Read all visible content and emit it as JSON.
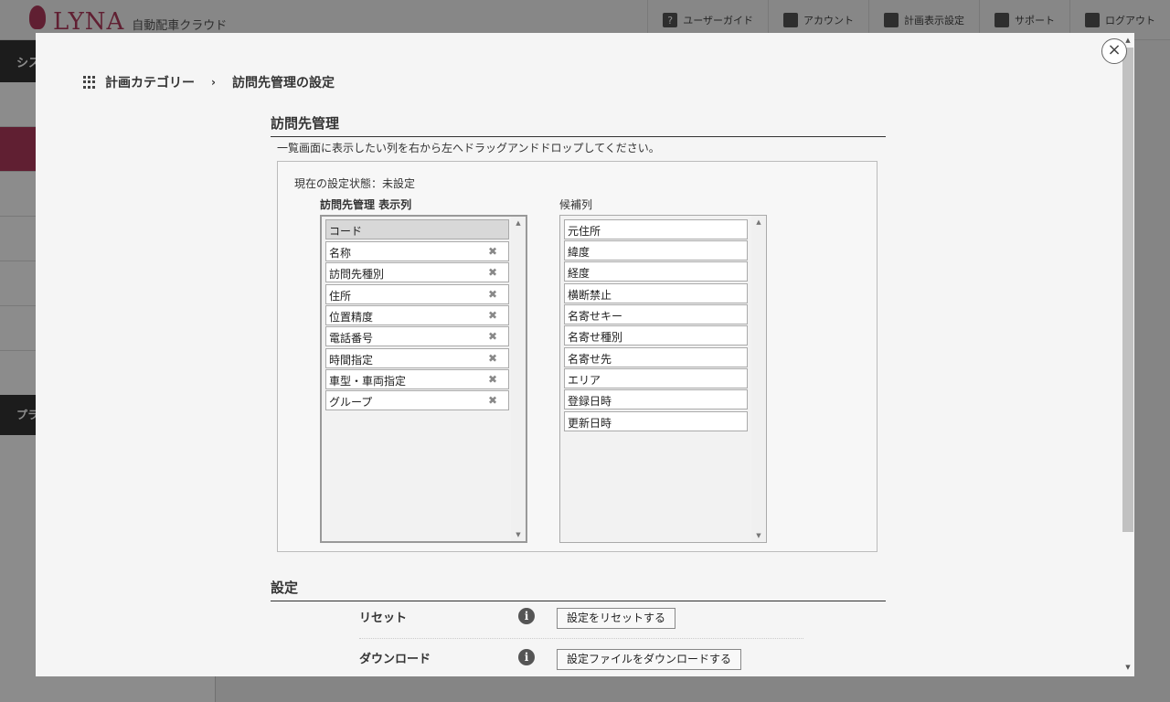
{
  "app": {
    "brand": "LYNA",
    "subtitle": "自動配車クラウド",
    "nav": [
      {
        "label": "ユーザーガイド",
        "icon": "question-icon"
      },
      {
        "label": "アカウント",
        "icon": "account-icon"
      },
      {
        "label": "計画表示設定",
        "icon": "gear-icon"
      },
      {
        "label": "サポート",
        "icon": "support-icon"
      },
      {
        "label": "ログアウト",
        "icon": "logout-icon"
      }
    ],
    "sidebar_head": "シス",
    "sidebar_head2": "プラ"
  },
  "modal": {
    "breadcrumb": {
      "category": "計画カテゴリー",
      "separator": "›",
      "current": "訪問先管理の設定"
    },
    "section1_title": "訪問先管理",
    "instruction": "一覧画面に表示したい列を右から左へドラッグアンドドロップしてください。",
    "status": "現在の設定状態：未設定",
    "display_label": "訪問先管理 表示列",
    "candidate_label": "候補列",
    "display_items": [
      {
        "label": "コード",
        "fixed": true
      },
      {
        "label": "名称"
      },
      {
        "label": "訪問先種別"
      },
      {
        "label": "住所"
      },
      {
        "label": "位置精度"
      },
      {
        "label": "電話番号"
      },
      {
        "label": "時間指定"
      },
      {
        "label": "車型・車両指定"
      },
      {
        "label": "グループ"
      }
    ],
    "candidate_items": [
      "元住所",
      "緯度",
      "経度",
      "横断禁止",
      "名寄せキー",
      "名寄せ種別",
      "名寄せ先",
      "エリア",
      "登録日時",
      "更新日時"
    ],
    "remove_glyph": "✖",
    "section2_title": "設定",
    "settings": [
      {
        "label": "リセット",
        "button": "設定をリセットする"
      },
      {
        "label": "ダウンロード",
        "button": "設定ファイルをダウンロードする"
      }
    ],
    "close_glyph": "×"
  }
}
